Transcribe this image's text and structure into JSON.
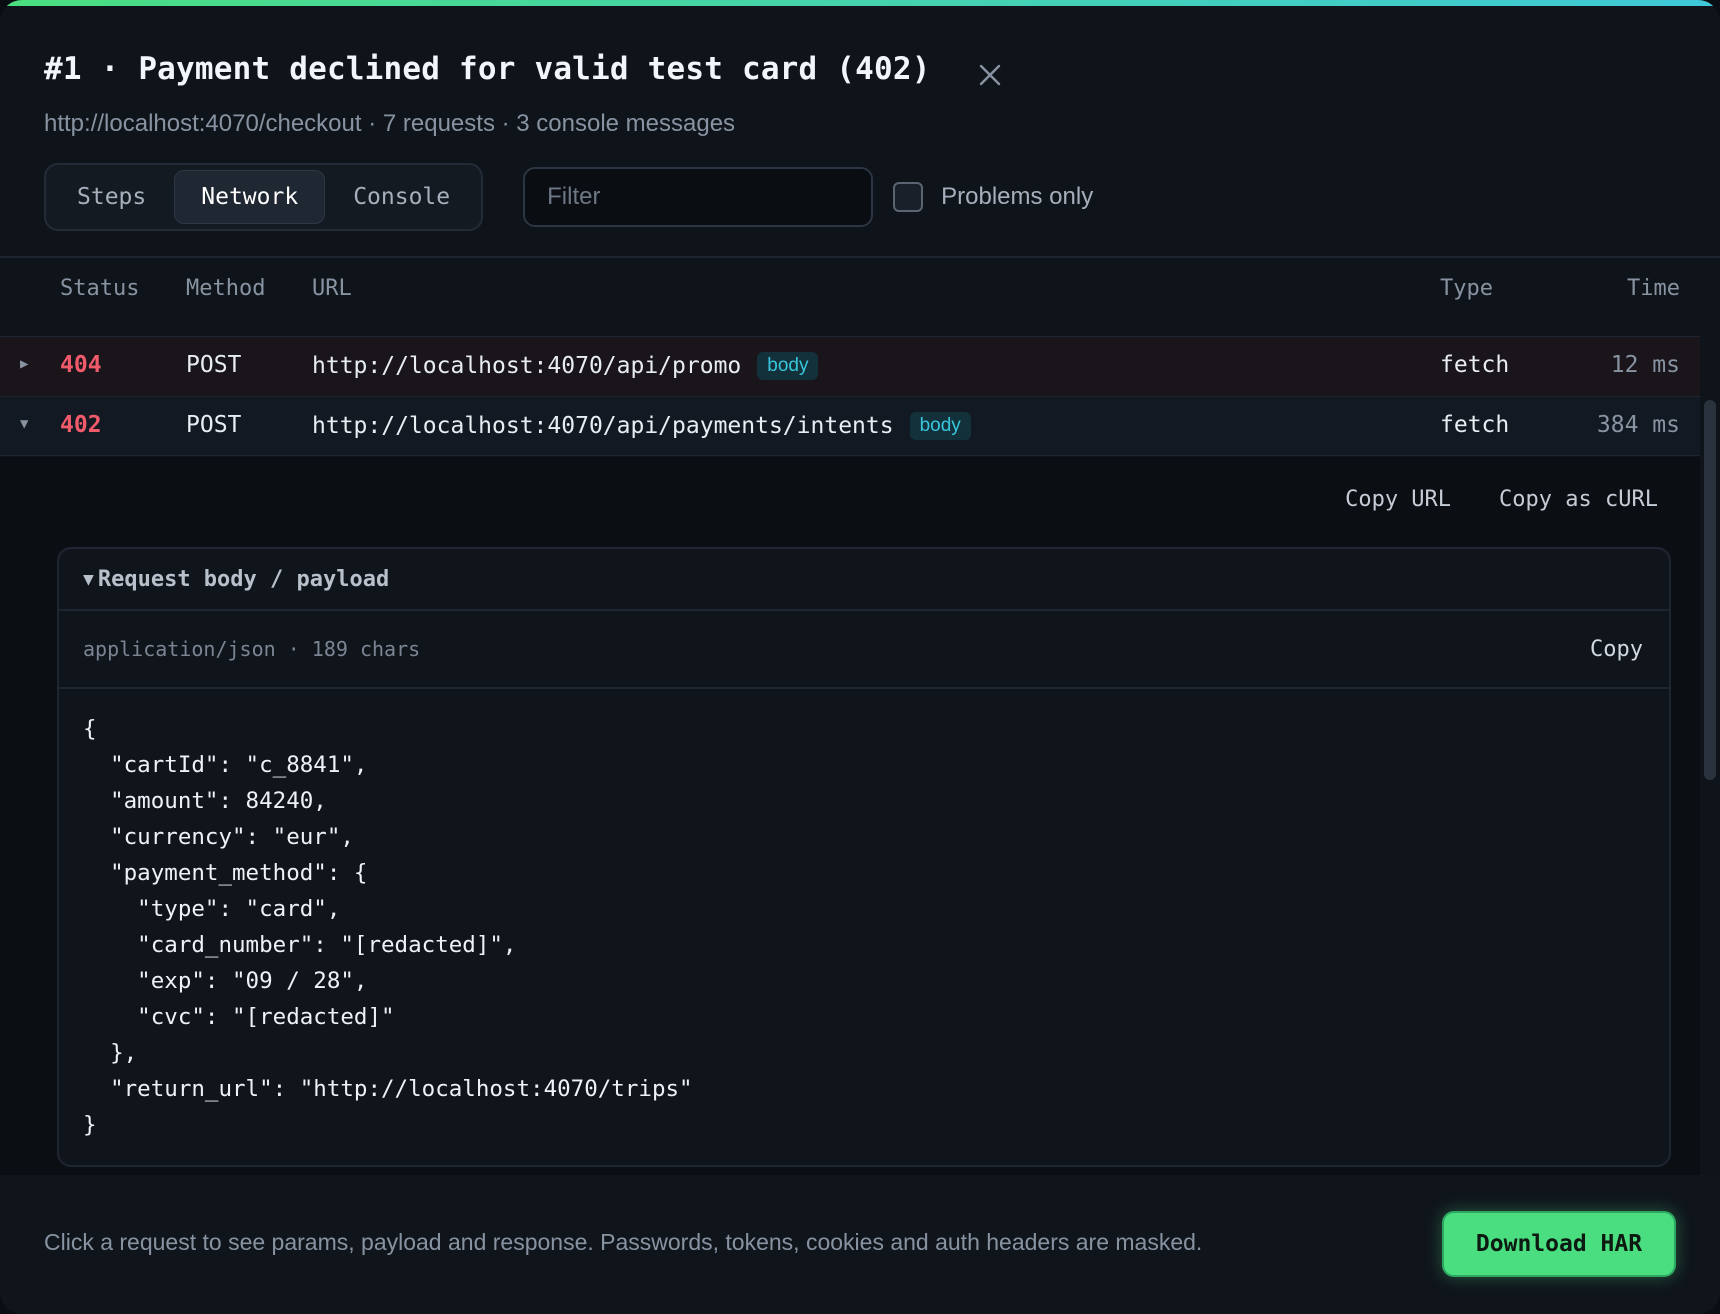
{
  "header": {
    "title": "#1 · Payment declined for valid test card (402)",
    "subtitle": "http://localhost:4070/checkout · 7 requests · 3 console messages"
  },
  "tabs": [
    {
      "label": "Steps",
      "active": false
    },
    {
      "label": "Network",
      "active": true
    },
    {
      "label": "Console",
      "active": false
    }
  ],
  "filter": {
    "placeholder": "Filter",
    "value": ""
  },
  "problems_only": {
    "label": "Problems only",
    "checked": false
  },
  "table": {
    "columns": [
      "Status",
      "Method",
      "URL",
      "Type",
      "Time"
    ],
    "rows": [
      {
        "status": "404",
        "method": "POST",
        "url": "http://localhost:4070/api/promo",
        "badge": "body",
        "type": "fetch",
        "time": "12 ms",
        "expanded": false
      },
      {
        "status": "402",
        "method": "POST",
        "url": "http://localhost:4070/api/payments/intents",
        "badge": "body",
        "type": "fetch",
        "time": "384 ms",
        "expanded": true
      }
    ]
  },
  "detail": {
    "copy_url": "Copy URL",
    "copy_curl": "Copy as cURL",
    "payload": {
      "summary": "Request body / payload",
      "meta": "application/json · 189 chars",
      "copy": "Copy",
      "body": "{\n  \"cartId\": \"c_8841\",\n  \"amount\": 84240,\n  \"currency\": \"eur\",\n  \"payment_method\": {\n    \"type\": \"card\",\n    \"card_number\": \"[redacted]\",\n    \"exp\": \"09 / 28\",\n    \"cvc\": \"[redacted]\"\n  },\n  \"return_url\": \"http://localhost:4070/trips\"\n}"
    }
  },
  "footer": {
    "text": "Click a request to see params, payload and response. Passwords, tokens, cookies and auth headers are masked.",
    "download_label": "Download HAR"
  },
  "colors": {
    "accent_green": "#4ade80",
    "accent_cyan": "#3fc8d8",
    "status_error": "#f05a6b",
    "badge": "#38c6dc"
  },
  "icons": {
    "close": "close-icon",
    "collapsed": "caret-right-icon",
    "expanded": "caret-down-icon"
  }
}
